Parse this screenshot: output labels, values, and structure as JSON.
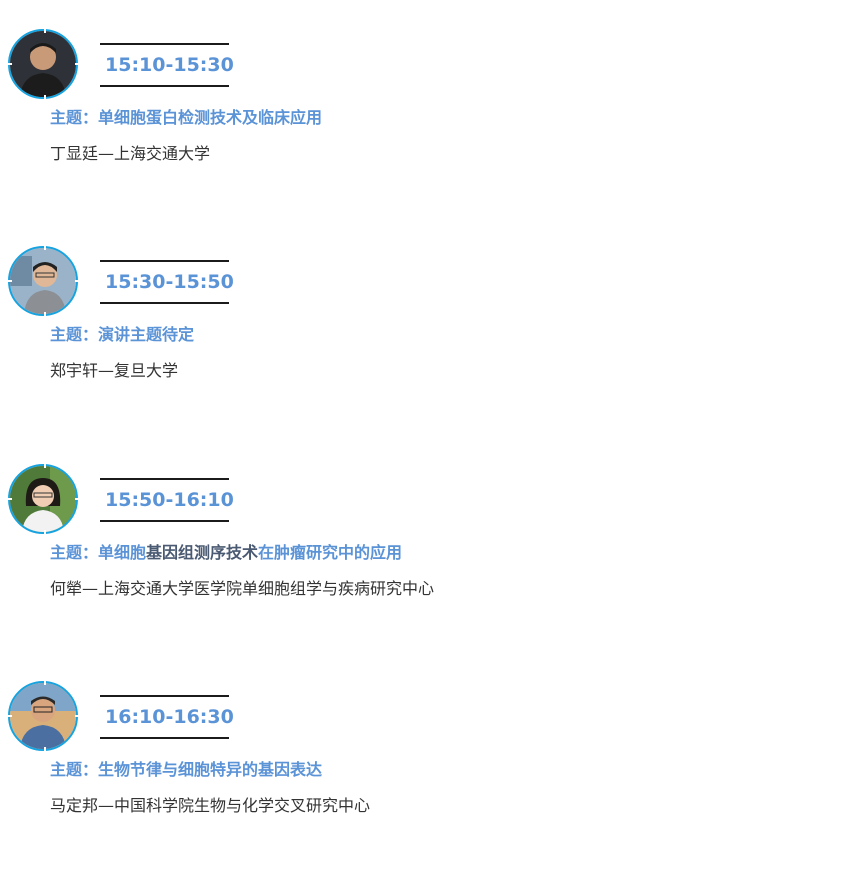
{
  "colors": {
    "accent": "#5b93d7",
    "avatar_ring": "#16a3e0",
    "time_rule": "#1b1b1b",
    "speaker_text": "#333333"
  },
  "sessions": [
    {
      "time": "15:10-15:30",
      "topic_prefix": "主题：单细胞蛋白检测技术及临床应用",
      "topic_dark": "",
      "topic_suffix": "",
      "speaker": "丁显廷—上海交通大学"
    },
    {
      "time": "15:30-15:50",
      "topic_prefix": "主题：演讲主题待定",
      "topic_dark": "",
      "topic_suffix": "",
      "speaker": "郑宇轩—复旦大学"
    },
    {
      "time": "15:50-16:10",
      "topic_prefix": "主题：单细胞",
      "topic_dark": "基因组测序技术",
      "topic_suffix": "在肿瘤研究中的应用",
      "speaker": "何犖—上海交通大学医学院单细胞组学与疾病研究中心"
    },
    {
      "time": "16:10-16:30",
      "topic_prefix": "主题：生物节律与细胞特异的基因表达",
      "topic_dark": "",
      "topic_suffix": "",
      "speaker": "马定邦—中国科学院生物与化学交叉研究中心"
    }
  ]
}
